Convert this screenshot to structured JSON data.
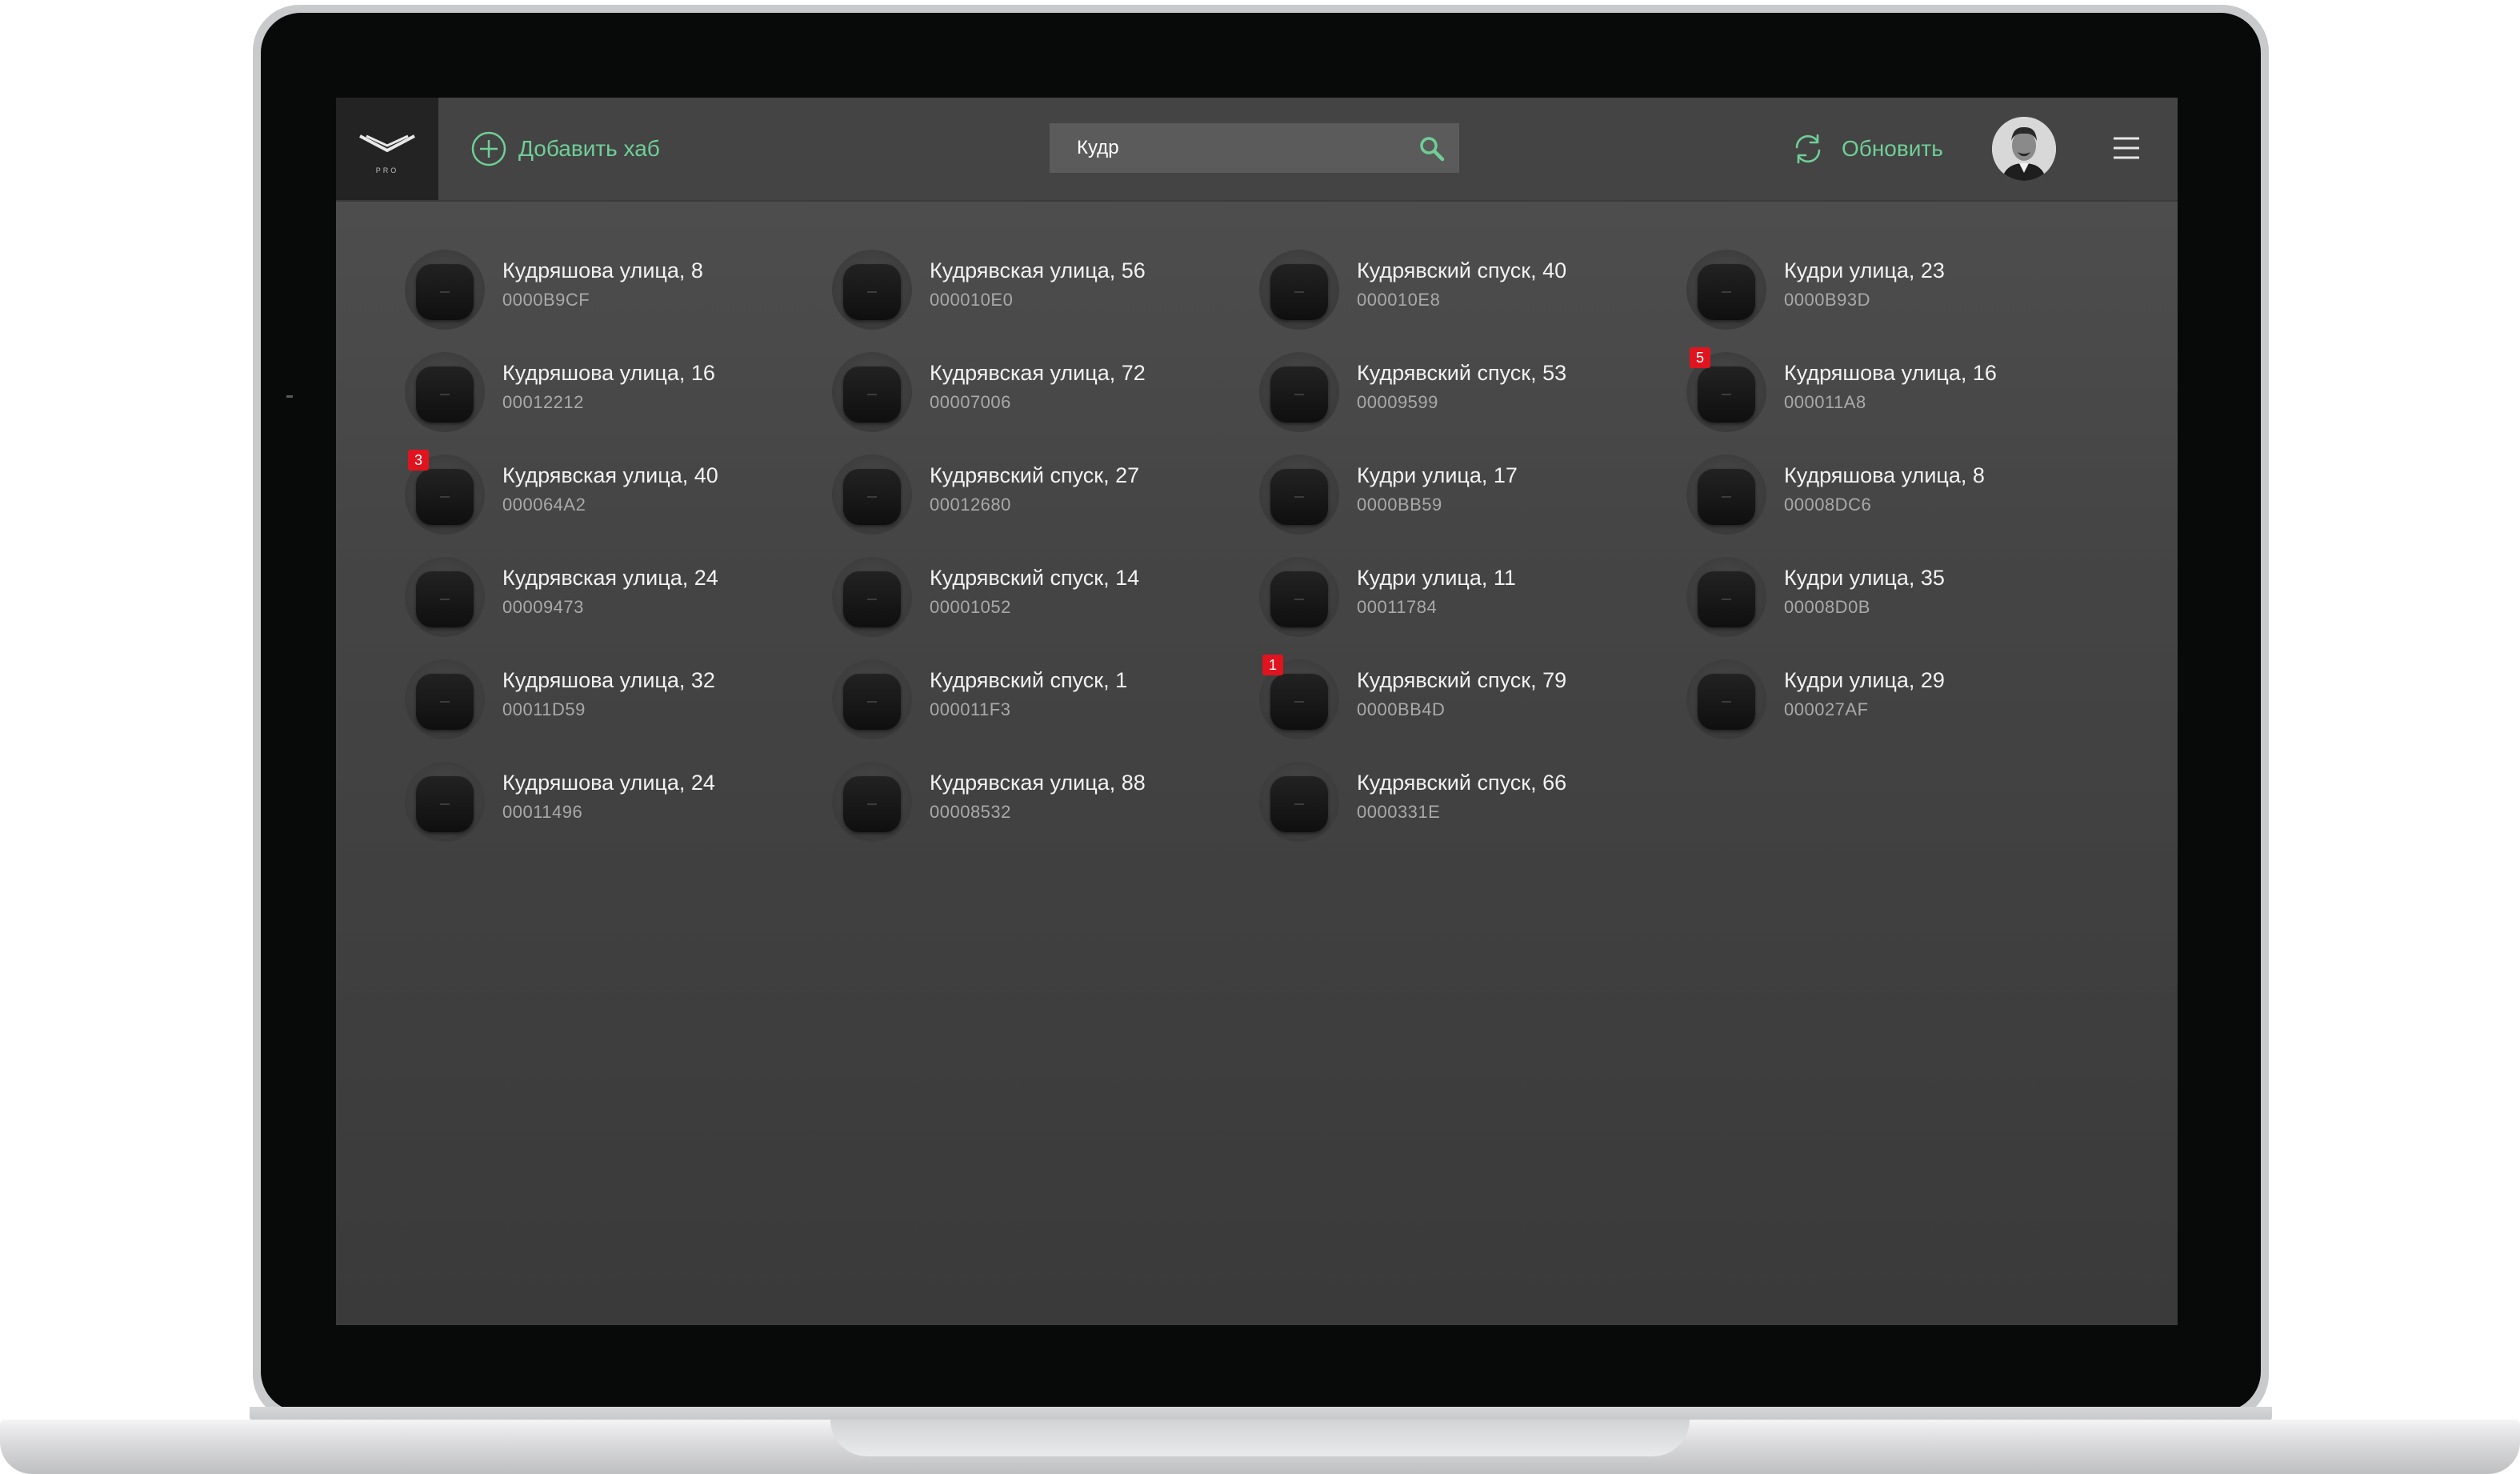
{
  "header": {
    "add_hub_label": "Добавить хаб",
    "search_value": "Кудр",
    "refresh_label": "Обновить",
    "logo_text": "PRO"
  },
  "colors": {
    "accent": "#6fcf97",
    "badge": "#e0141e",
    "background": "#3f3f3f"
  },
  "icons": {
    "logo": "ajax-logo-icon",
    "add": "plus-circle-icon",
    "search": "search-icon",
    "refresh": "refresh-icon",
    "menu": "hamburger-menu-icon"
  },
  "hubs": [
    {
      "name": "Кудряшова улица, 8",
      "id": "0000B9CF",
      "badge": ""
    },
    {
      "name": "Кудрявская улица, 56",
      "id": "000010E0",
      "badge": ""
    },
    {
      "name": "Кудрявский спуск, 40",
      "id": "000010E8",
      "badge": ""
    },
    {
      "name": "Кудри улица, 23",
      "id": "0000B93D",
      "badge": ""
    },
    {
      "name": "Кудряшова улица, 16",
      "id": "00012212",
      "badge": ""
    },
    {
      "name": "Кудрявская улица, 72",
      "id": "00007006",
      "badge": ""
    },
    {
      "name": "Кудрявский спуск, 53",
      "id": "00009599",
      "badge": ""
    },
    {
      "name": "Кудряшова улица, 16",
      "id": "000011A8",
      "badge": "5"
    },
    {
      "name": "Кудрявская улица, 40",
      "id": "000064A2",
      "badge": "3"
    },
    {
      "name": "Кудрявский спуск, 27",
      "id": "00012680",
      "badge": ""
    },
    {
      "name": "Кудри улица, 17",
      "id": "0000BB59",
      "badge": ""
    },
    {
      "name": "Кудряшова улица, 8",
      "id": "00008DC6",
      "badge": ""
    },
    {
      "name": "Кудрявская улица, 24",
      "id": "00009473",
      "badge": ""
    },
    {
      "name": "Кудрявский спуск, 14",
      "id": "00001052",
      "badge": ""
    },
    {
      "name": "Кудри улица, 11",
      "id": "00011784",
      "badge": ""
    },
    {
      "name": "Кудри улица, 35",
      "id": "00008D0B",
      "badge": ""
    },
    {
      "name": "Кудряшова улица, 32",
      "id": "00011D59",
      "badge": ""
    },
    {
      "name": "Кудрявский спуск, 1",
      "id": "000011F3",
      "badge": ""
    },
    {
      "name": "Кудрявский спуск, 79",
      "id": "0000BB4D",
      "badge": "1"
    },
    {
      "name": "Кудри улица, 29",
      "id": "000027AF",
      "badge": ""
    },
    {
      "name": "Кудряшова улица, 24",
      "id": "00011496",
      "badge": ""
    },
    {
      "name": "Кудрявская улица, 88",
      "id": "00008532",
      "badge": ""
    },
    {
      "name": "Кудрявский спуск, 66",
      "id": "0000331E",
      "badge": ""
    }
  ]
}
